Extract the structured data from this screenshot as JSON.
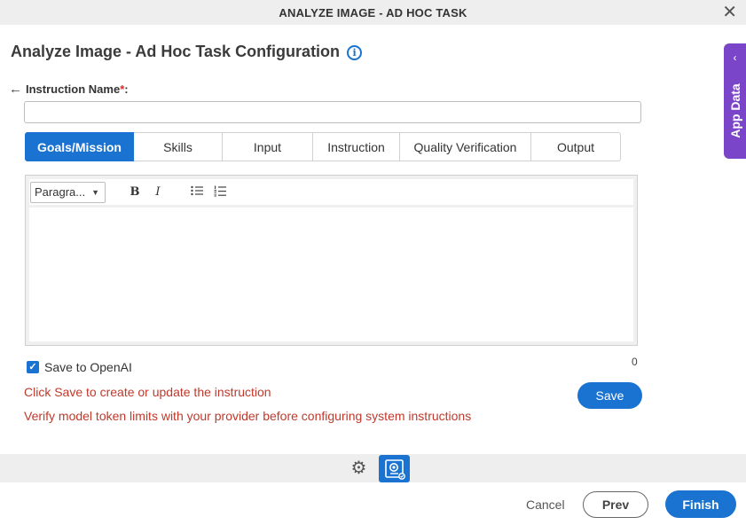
{
  "window": {
    "title": "ANALYZE IMAGE - AD HOC TASK",
    "close_icon": "close-icon"
  },
  "page": {
    "title": "Analyze Image - Ad Hoc Task Configuration",
    "info_icon": "info-icon"
  },
  "app_data": {
    "label": "App Data",
    "chevron": "‹"
  },
  "instruction": {
    "label": "Instruction Name",
    "required_mark": "*",
    "colon": ":",
    "value": "",
    "back_icon": "arrow-left-icon"
  },
  "tabs": [
    {
      "label": "Goals/Mission",
      "active": true
    },
    {
      "label": "Skills",
      "active": false
    },
    {
      "label": "Input",
      "active": false
    },
    {
      "label": "Instruction",
      "active": false
    },
    {
      "label": "Quality Verification",
      "active": false
    },
    {
      "label": "Output",
      "active": false
    }
  ],
  "editor": {
    "format_select": "Paragra...",
    "bold": "B",
    "italic": "I",
    "content": ""
  },
  "char_count": "0",
  "save_openai": {
    "label": "Save to OpenAI",
    "checked": true
  },
  "messages": {
    "save_hint": "Click Save to create or update the instruction",
    "token_warning": "Verify model token limits with your provider before configuring system instructions"
  },
  "buttons": {
    "save": "Save",
    "cancel": "Cancel",
    "prev": "Prev",
    "finish": "Finish"
  },
  "colors": {
    "accent": "#1a73d1",
    "app_data": "#7a45c9",
    "warning_text": "#c0392b"
  }
}
